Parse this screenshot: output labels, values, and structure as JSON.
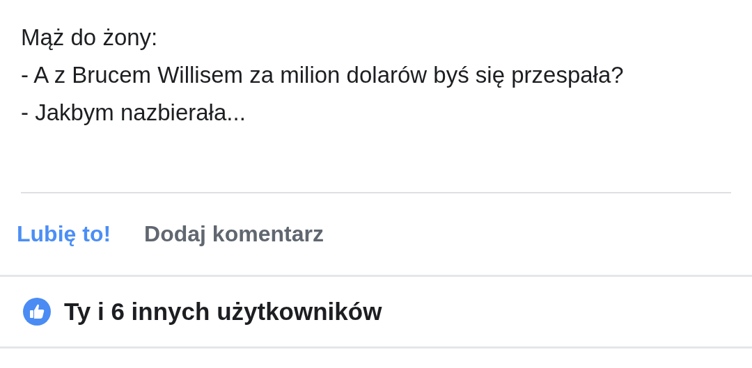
{
  "post": {
    "lines": [
      "Mąż do żony:",
      "- A z Brucem Willisem za milion dolarów byś się przespała?",
      "- Jakbym nazbierała..."
    ]
  },
  "actions": [
    {
      "label": "Lubię to!",
      "active": true
    },
    {
      "label": "Dodaj komentarz",
      "active": false
    }
  ],
  "likes": {
    "summary": "Ty i 6 innych użytkowników"
  }
}
